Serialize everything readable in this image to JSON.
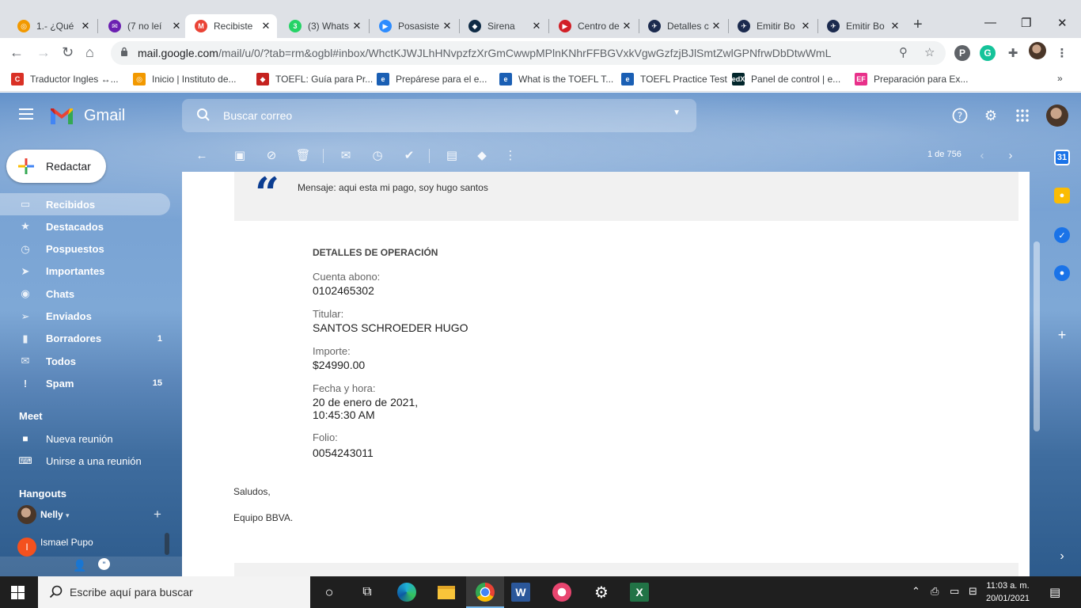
{
  "browser": {
    "tabs": [
      {
        "title": "1.- ¿Qué",
        "color": "#f29900",
        "glyph": "◎"
      },
      {
        "title": "(7 no leí",
        "color": "#6b1fb1",
        "glyph": "✉"
      },
      {
        "title": "Recibiste",
        "color": "#ea4335",
        "glyph": "M",
        "active": true
      },
      {
        "title": "(3) Whats",
        "color": "#25d366",
        "glyph": "3"
      },
      {
        "title": "Posasiste",
        "color": "#2d8cff",
        "glyph": "▶"
      },
      {
        "title": "Sirena",
        "color": "#0f2b46",
        "glyph": "◆"
      },
      {
        "title": "Centro de",
        "color": "#d21f26",
        "glyph": "▶"
      },
      {
        "title": "Detalles c",
        "color": "#1b2a4e",
        "glyph": "✈"
      },
      {
        "title": "Emitir Bo",
        "color": "#1b2a4e",
        "glyph": "✈"
      },
      {
        "title": "Emitir Bo",
        "color": "#1b2a4e",
        "glyph": "✈"
      }
    ],
    "close_glyph": "✕",
    "new_tab": "+",
    "window_controls": {
      "minimize": "—",
      "restore": "❐",
      "close": "✕"
    },
    "url_host": "mail.google.com",
    "url_path": "/mail/u/0/?tab=rm&ogbl#inbox/WhctKJWJLhHNvpzfzXrGmCwwpMPlnKNhrFFBGVxkVgwGzfzjBJlSmtZwlGPNfrwDbDtwWmL",
    "nav": {
      "back": "←",
      "forward": "→",
      "reload": "↻",
      "home": "⌂"
    },
    "bookmarks": [
      {
        "label": "Traductor Ingles ↔...",
        "color": "#d93025",
        "glyph": "C"
      },
      {
        "label": "Inicio | Instituto de...",
        "color": "#f29900",
        "glyph": "◎"
      },
      {
        "label": "TOEFL: Guía para Pr...",
        "color": "#c5221f",
        "glyph": "◆"
      },
      {
        "label": "Prepárese para el e...",
        "color": "#1a5fb4",
        "glyph": "e"
      },
      {
        "label": "What is the TOEFL T...",
        "color": "#1a5fb4",
        "glyph": "e"
      },
      {
        "label": "TOEFL Practice Test",
        "color": "#1a5fb4",
        "glyph": "e"
      },
      {
        "label": "Panel de control | e...",
        "color": "#02262b",
        "glyph": "edX"
      },
      {
        "label": "Preparación para Ex...",
        "color": "#e8308a",
        "glyph": "EF"
      }
    ],
    "bookmarks_more": "»"
  },
  "gmail": {
    "app_name": "Gmail",
    "search_placeholder": "Buscar correo",
    "compose_label": "Redactar",
    "nav_items": [
      {
        "label": "Recibidos",
        "icon": "inbox-icon",
        "glyph": "▭",
        "count": "",
        "active": true
      },
      {
        "label": "Destacados",
        "icon": "star-icon",
        "glyph": "★",
        "count": ""
      },
      {
        "label": "Pospuestos",
        "icon": "clock-icon",
        "glyph": "◷",
        "count": ""
      },
      {
        "label": "Importantes",
        "icon": "important-icon",
        "glyph": "➤",
        "count": ""
      },
      {
        "label": "Chats",
        "icon": "chat-icon",
        "glyph": "◉",
        "count": ""
      },
      {
        "label": "Enviados",
        "icon": "send-icon",
        "glyph": "➢",
        "count": ""
      },
      {
        "label": "Borradores",
        "icon": "draft-icon",
        "glyph": "▮",
        "count": "1"
      },
      {
        "label": "Todos",
        "icon": "all-mail-icon",
        "glyph": "✉",
        "count": ""
      },
      {
        "label": "Spam",
        "icon": "spam-icon",
        "glyph": "!",
        "count": "15"
      }
    ],
    "meet": {
      "heading": "Meet",
      "items": [
        {
          "label": "Nueva reunión",
          "glyph": "■"
        },
        {
          "label": "Unirse a una reunión",
          "glyph": "⌨"
        }
      ]
    },
    "hangouts": {
      "heading": "Hangouts",
      "user": "Nelly",
      "contact": "Ismael Pupo",
      "contact_initial": "I",
      "add": "+"
    },
    "pager": "1 de 756",
    "message": {
      "quote": "Mensaje: aqui esta mi pago, soy hugo santos",
      "details_heading": "DETALLES DE OPERACIÓN",
      "fields": [
        {
          "label": "Cuenta abono:",
          "value": "0102465302"
        },
        {
          "label": "Titular:",
          "value": "SANTOS SCHROEDER HUGO"
        },
        {
          "label": "Importe:",
          "value": "$24990.00"
        },
        {
          "label": "Fecha y hora:",
          "value": "20 de enero de 2021,\n10:45:30 AM"
        },
        {
          "label": "Folio:",
          "value": "0054243011"
        }
      ],
      "greeting": "Saludos,",
      "signature": "Equipo BBVA."
    }
  },
  "taskbar": {
    "search_placeholder": "Escribe aquí para buscar",
    "time": "11:03 a. m.",
    "date": "20/01/2021"
  }
}
